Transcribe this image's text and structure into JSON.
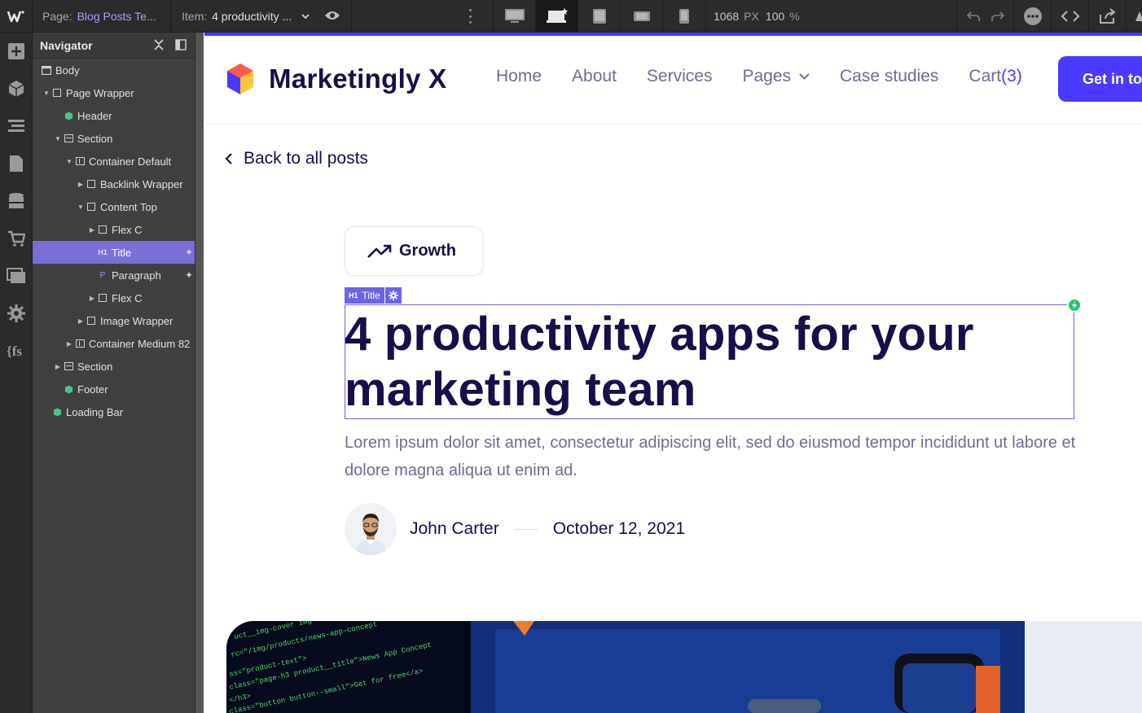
{
  "topbar": {
    "page_label": "Page:",
    "page_value": "Blog Posts Te...",
    "item_label": "Item:",
    "item_value": "4 productivity ...",
    "width_value": "1068",
    "width_unit": "PX",
    "zoom_value": "100",
    "zoom_unit": "%"
  },
  "navigator": {
    "title": "Navigator",
    "tree": [
      {
        "label": "Body"
      },
      {
        "label": "Page Wrapper"
      },
      {
        "label": "Header"
      },
      {
        "label": "Section"
      },
      {
        "label": "Container Default"
      },
      {
        "label": "Backlink Wrapper"
      },
      {
        "label": "Content Top"
      },
      {
        "label": "Flex C"
      },
      {
        "label": "Title"
      },
      {
        "label": "Paragraph"
      },
      {
        "label": "Flex C"
      },
      {
        "label": "Image Wrapper"
      },
      {
        "label": "Container Medium 82"
      },
      {
        "label": "Section"
      },
      {
        "label": "Footer"
      },
      {
        "label": "Loading Bar"
      }
    ]
  },
  "site": {
    "brand": "Marketingly X",
    "menu": {
      "home": "Home",
      "about": "About",
      "services": "Services",
      "pages": "Pages",
      "case_studies": "Case studies",
      "cart": "Cart",
      "cart_count": "(3)"
    },
    "cta": "Get in touch",
    "back_link": "Back to all posts",
    "tag": "Growth",
    "selection_badge": "Title",
    "title": "4 productivity apps for your marketing team",
    "paragraph": "Lorem ipsum dolor sit amet, consectetur adipiscing elit, sed do eiusmod tempor incididunt ut labore et dolore magna aliqua ut enim ad.",
    "author": "John Carter",
    "date": "October 12, 2021"
  },
  "colors": {
    "accent": "#4a3aff",
    "heading": "#170f49",
    "body_text": "#6f6c90",
    "selection": "#6c63e8"
  }
}
